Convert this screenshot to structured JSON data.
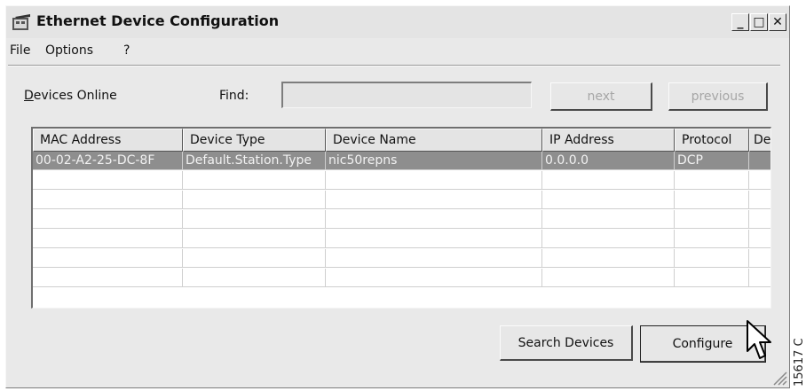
{
  "window": {
    "title": "Ethernet Device Configuration",
    "minimize": "_",
    "maximize": "□",
    "close": "✕"
  },
  "menu": [
    "File",
    "Options",
    "?"
  ],
  "toolbar": {
    "devices_online_label": "Devices Online",
    "find_label": "Find:",
    "find_value": "",
    "next_label": "next",
    "previous_label": "previous"
  },
  "table": {
    "columns": [
      "MAC Address",
      "Device Type",
      "Device Name",
      "IP Address",
      "Protocol",
      "De"
    ],
    "rows": [
      [
        "00-02-A2-25-DC-8F",
        "Default.Station.Type",
        "nic50repns",
        "0.0.0.0",
        "DCP",
        ""
      ]
    ],
    "empty_rows": 6
  },
  "buttons": {
    "search_devices": "Search Devices",
    "configure": "Configure"
  },
  "figure_code": "15617 C",
  "colors": {
    "window_bg": "#e9e9e9",
    "selected_row": "#8e8e8e",
    "disabled_text": "#a6a6a6"
  }
}
